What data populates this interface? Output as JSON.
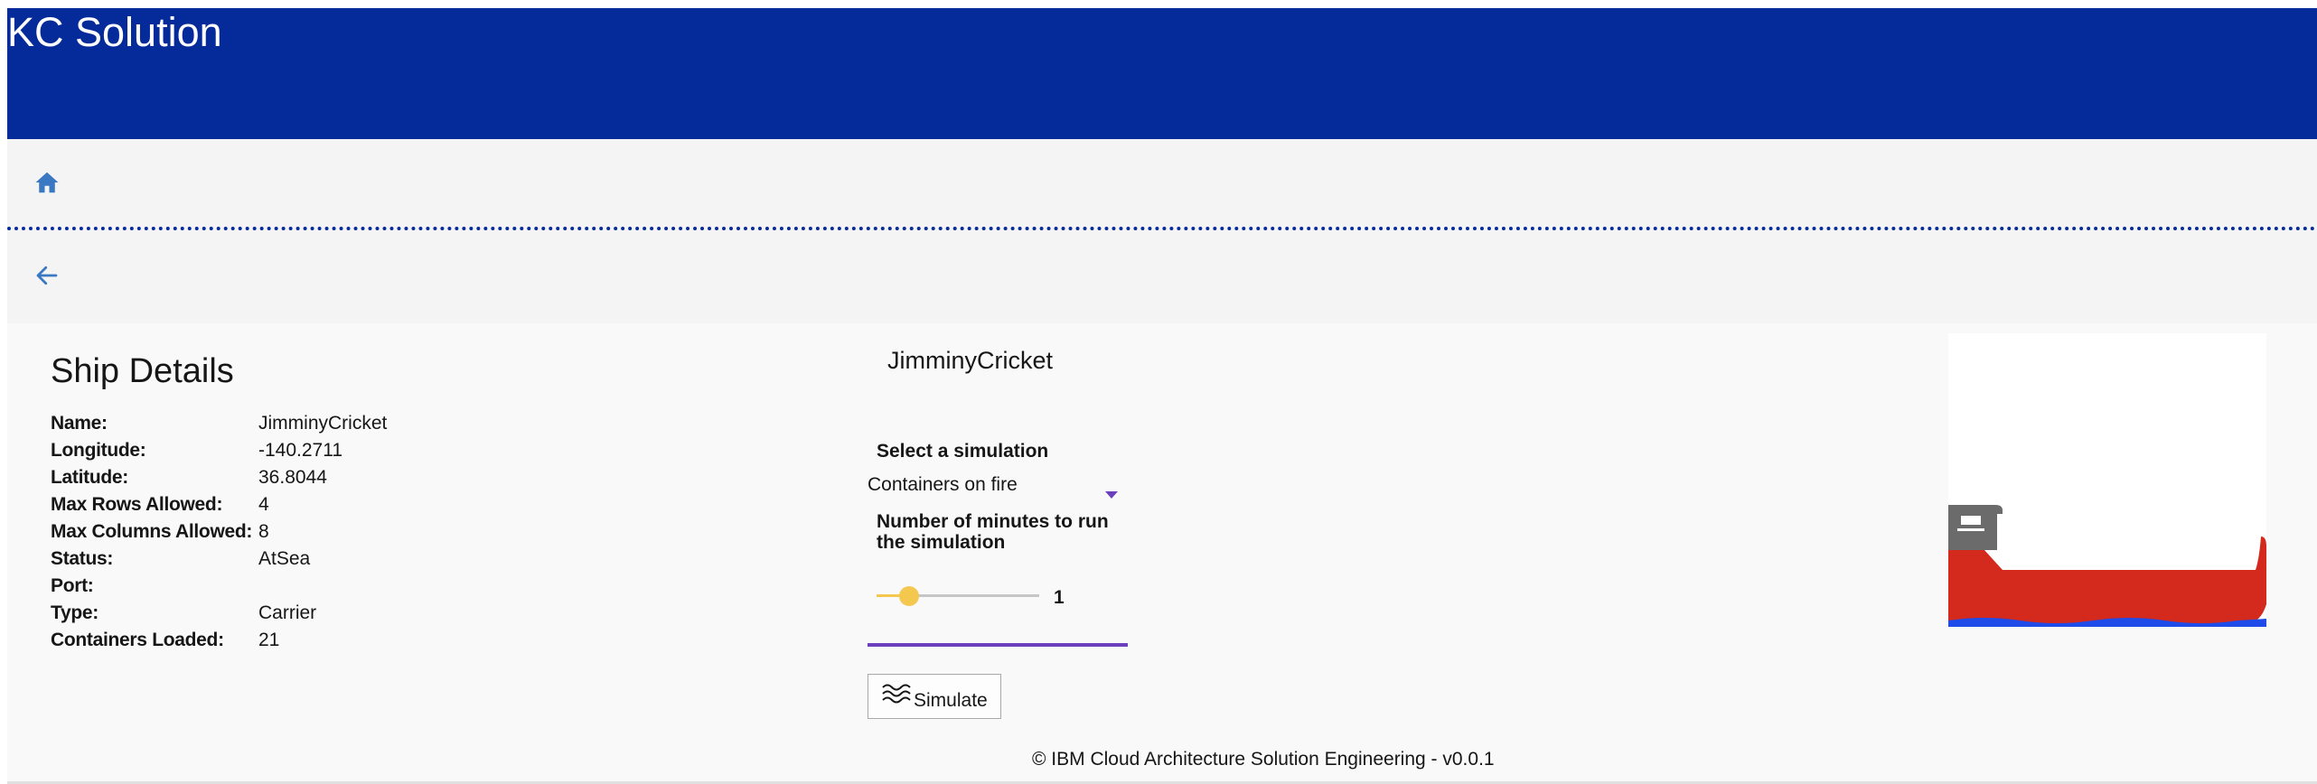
{
  "header": {
    "app_title": "KC Solution",
    "background_color": "#052a9a"
  },
  "nav": {
    "home_icon": "home-icon",
    "back_icon": "arrow-left-icon",
    "icon_color": "#3a78c3"
  },
  "ship_details": {
    "heading": "Ship Details",
    "rows": [
      {
        "label": "Name:",
        "value": "JimminyCricket"
      },
      {
        "label": "Longitude:",
        "value": "-140.2711"
      },
      {
        "label": "Latitude:",
        "value": "36.8044"
      },
      {
        "label": "Max Rows Allowed:",
        "value": "4"
      },
      {
        "label": "Max Columns Allowed:",
        "value": "8"
      },
      {
        "label": "Status:",
        "value": "AtSea"
      },
      {
        "label": "Port:",
        "value": ""
      },
      {
        "label": "Type:",
        "value": "Carrier"
      },
      {
        "label": "Containers Loaded:",
        "value": "21"
      }
    ]
  },
  "simulation": {
    "ship_name": "JimminyCricket",
    "select_label": "Select a simulation",
    "selected_option": "Containers on fire",
    "minutes_label": "Number of minutes to run the simulation",
    "minutes_value": "1",
    "slider_fraction": 0.2,
    "slider_color": "#f4c74f",
    "accent_color": "#6c3fbf",
    "simulate_button_label": "Simulate",
    "simulate_icon": "waves-icon"
  },
  "ship_image": {
    "icon": "container-ship-icon",
    "hull_color": "#d42a1e",
    "bridge_color": "#6b6b6b",
    "water_color": "#1f4be8"
  },
  "footer": {
    "text": "© IBM Cloud Architecture Solution Engineering - v0.0.1"
  }
}
